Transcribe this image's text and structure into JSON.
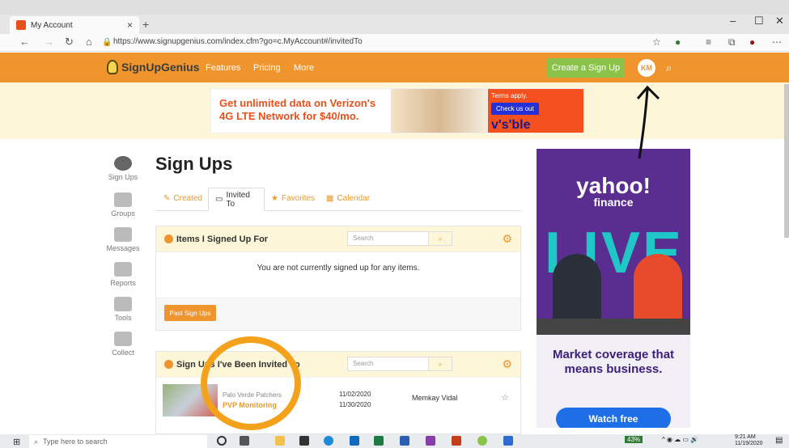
{
  "browser": {
    "tab_title": "My Account",
    "tab_close": "×",
    "new_tab": "+",
    "url": "https://www.signupgenius.com/index.cfm?go=c.MyAccount#/invitedTo",
    "window_controls": [
      "–",
      "☐",
      "✕"
    ]
  },
  "site": {
    "logo": "SignUpGenius",
    "nav": [
      "Features",
      "Pricing",
      "More"
    ],
    "create_button": "Create a Sign Up",
    "avatar_initials": "KM",
    "accent": "#f0942e",
    "create_color": "#8bc34a"
  },
  "banner_ad": {
    "headline": "Get unlimited data on Verizon's 4G LTE Network for $40/mo.",
    "terms": "Terms apply.",
    "cta": "Check us out",
    "brand": "v's'ble"
  },
  "sidebar": {
    "items": [
      {
        "label": "Sign Ups",
        "icon": "sign-ups-icon"
      },
      {
        "label": "Groups",
        "icon": "groups-icon"
      },
      {
        "label": "Messages",
        "icon": "messages-icon"
      },
      {
        "label": "Reports",
        "icon": "reports-icon"
      },
      {
        "label": "Tools",
        "icon": "tools-icon"
      },
      {
        "label": "Collect",
        "icon": "collect-icon"
      }
    ]
  },
  "main": {
    "title": "Sign Ups",
    "tabs": [
      "Created",
      "Invited To",
      "Favorites",
      "Calendar"
    ],
    "active_tab": "Invited To",
    "panel1": {
      "title": "Items I Signed Up For",
      "search_placeholder": "Search",
      "empty_message": "You are not currently signed up for any items.",
      "past_button": "Past Sign Ups"
    },
    "panel2": {
      "title": "Sign Ups I've Been Invited To",
      "search_placeholder": "Search",
      "rows": [
        {
          "org": "Palo Verde Patchers",
          "title": "PVP Monitoring",
          "start": "11/02/2020",
          "end": "11/30/2020",
          "owner": "Memkay Vidal"
        }
      ]
    }
  },
  "side_ad": {
    "logo": "yahoo!",
    "sub": "finance",
    "live": "LIVE",
    "headline": "Market coverage that means business.",
    "cta": "Watch free"
  },
  "taskbar": {
    "search_placeholder": "Type here to search",
    "battery": "43%",
    "time": "9:21 AM",
    "date": "11/19/2020"
  }
}
